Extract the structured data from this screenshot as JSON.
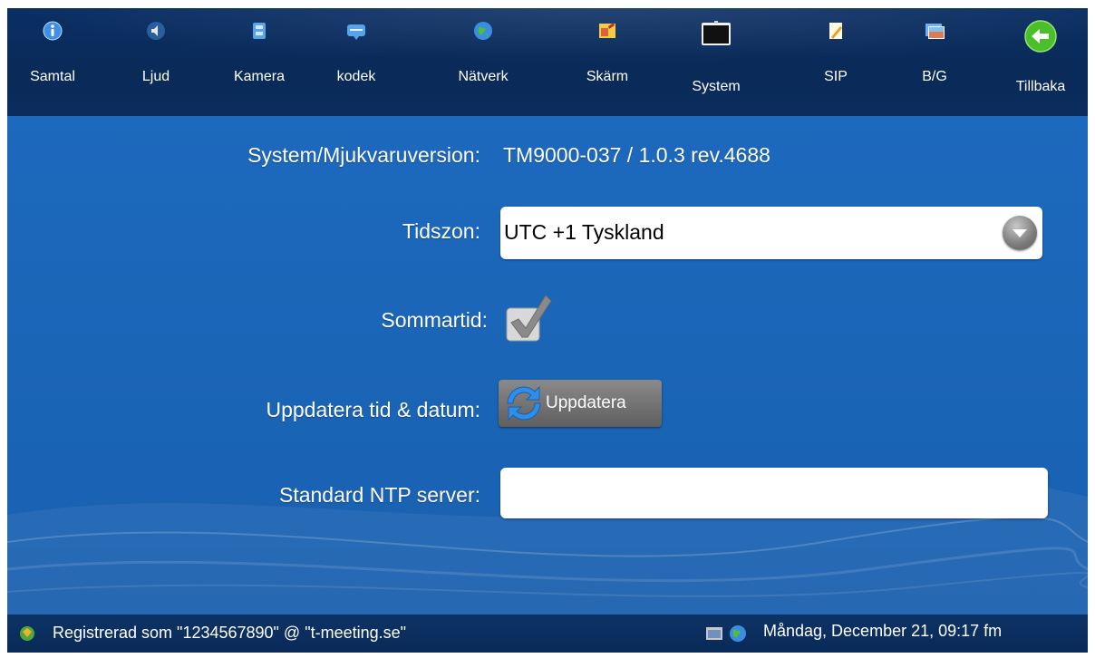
{
  "nav": {
    "items": [
      {
        "label": "Samtal",
        "icon": "info-icon"
      },
      {
        "label": "Ljud",
        "icon": "speaker-icon"
      },
      {
        "label": "Kamera",
        "icon": "film-icon"
      },
      {
        "label": "kodek",
        "icon": "codec-icon"
      },
      {
        "label": "Nätverk",
        "icon": "globe-icon"
      },
      {
        "label": "Skärm",
        "icon": "display-icon"
      },
      {
        "label": "System",
        "icon": "monitor-icon",
        "selected": true
      },
      {
        "label": "SIP",
        "icon": "document-icon"
      },
      {
        "label": "B/G",
        "icon": "picture-icon"
      },
      {
        "label": "Tillbaka",
        "icon": "back-arrow-icon"
      }
    ]
  },
  "system": {
    "version_label": "System/Mjukvaruversion:",
    "version_value": "TM9000-037 / 1.0.3 rev.4688",
    "timezone_label": "Tidszon:",
    "timezone_value": "UTC +1 Tyskland",
    "dst_label": "Sommartid:",
    "dst_checked": true,
    "update_label": "Uppdatera tid & datum:",
    "update_button": "Uppdatera",
    "ntp_label": "Standard NTP server:",
    "ntp_value": ""
  },
  "status": {
    "registration": "Registrerad som \"1234567890\" @ \"t-meeting.se\"",
    "datetime": "Måndag, December 21, 09:17 fm"
  },
  "colors": {
    "background": "#1a63b4",
    "topbar": "#0b2d5d",
    "back_button": "#4bbf2a"
  }
}
